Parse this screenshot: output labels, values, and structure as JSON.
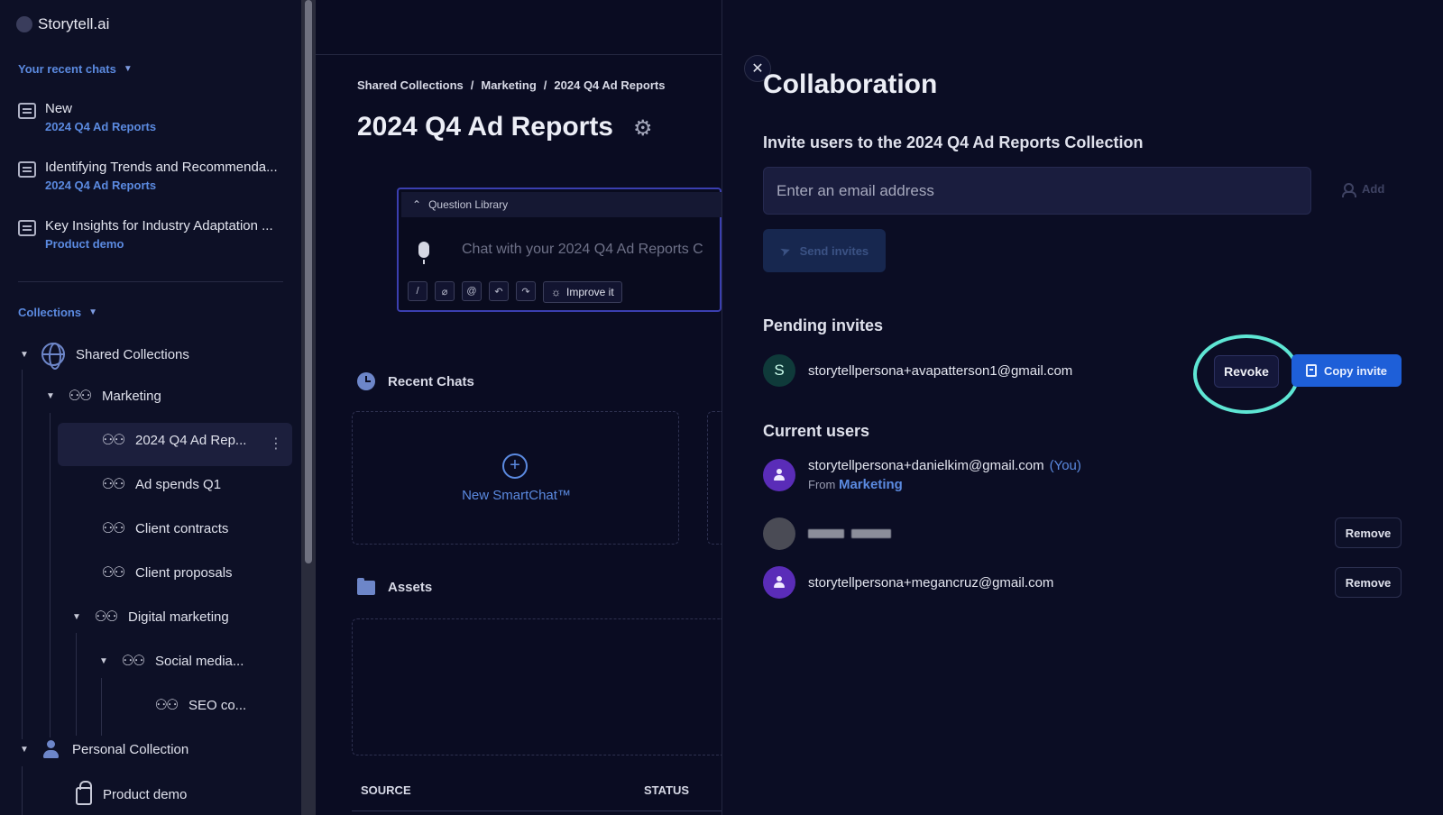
{
  "sidebar": {
    "brand": "Storytell.ai",
    "recent_chats_label": "Your recent chats",
    "recent_chats": [
      {
        "title": "New",
        "collection": "2024 Q4 Ad Reports"
      },
      {
        "title": "Identifying Trends and Recommenda...",
        "collection": "2024 Q4 Ad Reports"
      },
      {
        "title": "Key Insights for Industry Adaptation ...",
        "collection": "Product demo"
      }
    ],
    "collections_label": "Collections",
    "tree": {
      "shared": "Shared Collections",
      "marketing": "Marketing",
      "ad_reports": "2024 Q4 Ad Rep...",
      "ad_spends": "Ad spends Q1",
      "client_contracts": "Client contracts",
      "client_proposals": "Client proposals",
      "digital_marketing": "Digital marketing",
      "social_media": "Social media...",
      "seo": "SEO co...",
      "personal": "Personal Collection",
      "product_demo": "Product demo"
    }
  },
  "main": {
    "breadcrumb": [
      "Shared Collections",
      "/",
      "Marketing",
      "/",
      "2024 Q4 Ad Reports"
    ],
    "title": "2024 Q4 Ad Reports",
    "question_library": "Question Library",
    "chat_placeholder": "Chat with your 2024 Q4 Ad Reports C",
    "improve_label": "Improve it",
    "recent_chats_label": "Recent Chats",
    "new_smartchat": "New SmartChat™",
    "assets_label": "Assets",
    "col_source": "SOURCE",
    "col_status": "STATUS"
  },
  "panel": {
    "title": "Collaboration",
    "invite_heading": "Invite users to the 2024 Q4 Ad Reports Collection",
    "email_placeholder": "Enter an email address",
    "add_label": "Add",
    "send_label": "Send invites",
    "pending_heading": "Pending invites",
    "pending": [
      {
        "initial": "S",
        "email": "storytellpersona+avapatterson1@gmail.com"
      }
    ],
    "revoke_label": "Revoke",
    "copy_invite_label": "Copy invite",
    "current_heading": "Current users",
    "current_users": [
      {
        "email": "storytellpersona+danielkim@gmail.com",
        "you": "(You)",
        "from_prefix": "From",
        "from": "Marketing"
      },
      {
        "email": "",
        "redacted": true
      },
      {
        "email": "storytellpersona+megancruz@gmail.com"
      }
    ],
    "remove_label": "Remove"
  },
  "colors": {
    "accent_blue": "#5b8ae0",
    "primary_button": "#1e5fd8",
    "highlight_ring": "#5ee6d4",
    "avatar_purple": "#5a2cb8"
  }
}
